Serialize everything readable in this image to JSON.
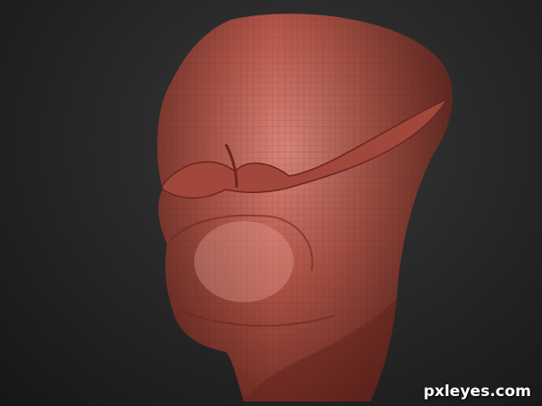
{
  "scene": {
    "subject": "sculpted-head",
    "skin_color": "#b5574a",
    "background_color": "#262626"
  },
  "watermark": {
    "text": "pxleyes.com"
  }
}
